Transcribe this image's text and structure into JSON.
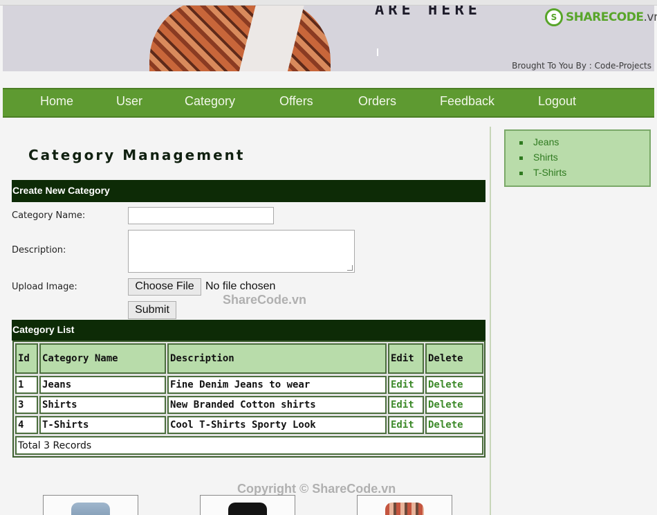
{
  "banner": {
    "headline": "ARE HERE",
    "credit": "Brought To You By : Code-Projects",
    "logo_text": "SHARECODE",
    "logo_suffix": ".vn"
  },
  "nav": {
    "items": [
      "Home",
      "User",
      "Category",
      "Offers",
      "Orders",
      "Feedback",
      "Logout"
    ]
  },
  "sidebar": {
    "categories": [
      "Jeans",
      "Shirts",
      "T-Shirts"
    ]
  },
  "page": {
    "title": "Category Management"
  },
  "create_form": {
    "heading": "Create New Category",
    "name_label": "Category Name:",
    "name_value": "",
    "description_label": "Description:",
    "description_value": "",
    "upload_label": "Upload Image:",
    "choose_file_label": "Choose File",
    "file_status": "No file chosen",
    "submit_label": "Submit"
  },
  "category_list": {
    "heading": "Category List",
    "columns": [
      "Id",
      "Category Name",
      "Description",
      "Edit",
      "Delete"
    ],
    "rows": [
      {
        "id": "1",
        "name": "Jeans",
        "description": "Fine Denim Jeans to wear",
        "edit": "Edit",
        "delete": "Delete"
      },
      {
        "id": "3",
        "name": "Shirts",
        "description": "New Branded Cotton shirts",
        "edit": "Edit",
        "delete": "Delete"
      },
      {
        "id": "4",
        "name": "T-Shirts",
        "description": "Cool T-Shirts Sporty Look",
        "edit": "Edit",
        "delete": "Delete"
      }
    ],
    "total": "Total 3 Records"
  },
  "watermarks": {
    "center": "ShareCode.vn",
    "footer": "Copyright © ShareCode.vn"
  },
  "colors": {
    "nav": "#5e9a31",
    "section_header": "#0d2b06",
    "table_header": "#b8dcaa",
    "link": "#3d8a2a"
  }
}
